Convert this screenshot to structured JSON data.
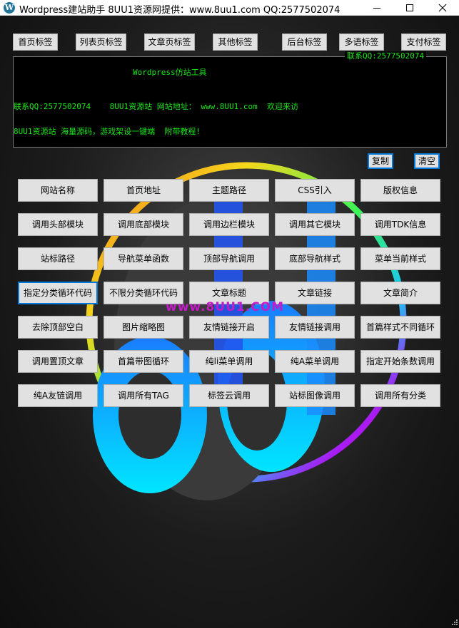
{
  "window": {
    "title": "Wordpress建站助手 8UU1资源网提供：www.8uu1.com QQ:2577502074",
    "app_icon_glyph": "W"
  },
  "tabs": [
    {
      "label": "首页标签"
    },
    {
      "label": "列表页标签"
    },
    {
      "label": "文章页标签"
    },
    {
      "label": "其他标签"
    },
    {
      "label": "后台标签"
    },
    {
      "label": "多语标签"
    },
    {
      "label": "支付标签"
    }
  ],
  "log": {
    "legend": "联系QQ:2577502074",
    "lines": [
      "Wordpress仿站工具",
      "联系QQ:2577502074    8UU1资源站 网站地址： www.8UU1.com  欢迎来访",
      "8UU1资源站 海量源码，游戏架设一键端  附带教程!"
    ]
  },
  "actions": {
    "copy_label": "复制",
    "clear_label": "清空"
  },
  "grid": [
    [
      "网站名称",
      "首页地址",
      "主题路径",
      "CSS引入",
      "版权信息"
    ],
    [
      "调用头部模块",
      "调用底部模块",
      "调用边栏模块",
      "调用其它模块",
      "调用TDK信息"
    ],
    [
      "站标路径",
      "导航菜单函数",
      "顶部导航调用",
      "底部导航样式",
      "菜单当前样式"
    ],
    [
      "指定分类循环代码",
      "不限分类循环代码",
      "文章标题",
      "文章链接",
      "文章简介"
    ],
    [
      "去除顶部空白",
      "图片缩略图",
      "友情链接开启",
      "友情链接调用",
      "首篇样式不同循环"
    ],
    [
      "调用置顶文章",
      "首篇带图循环",
      "纯li菜单调用",
      "纯A菜单调用",
      "指定开始条数调用"
    ],
    [
      "纯A友链调用",
      "调用所有TAG",
      "标签云调用",
      "站标图像调用",
      "调用所有分类"
    ]
  ],
  "watermark": "www.8UU1.COM",
  "colors": {
    "log_text": "#19e619",
    "watermark": "#c21bc7",
    "focus": "#0078d7"
  }
}
